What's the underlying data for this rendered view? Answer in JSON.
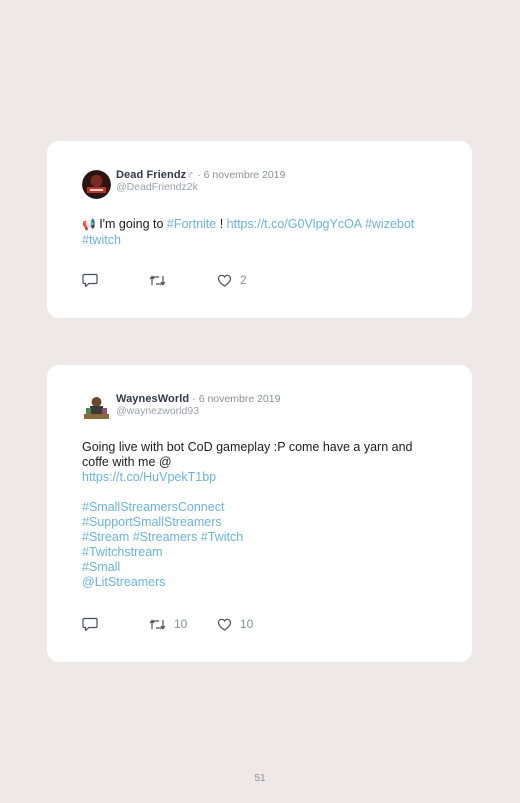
{
  "tweets": [
    {
      "name": "Dead Friendz",
      "name_suffix": "♂",
      "date": "· 6 novembre 2019",
      "handle": "@DeadFriendz2k",
      "emoji": "📢",
      "text_pre": "I'm going to ",
      "hashtag_1": "#Fortnite",
      "text_mid": " ! ",
      "url": "https://t.co/G0VlpgYcOA",
      "hashtag_2": "#wizebot",
      "hashtag_3": "#twitch",
      "retweets": "",
      "likes": "2"
    },
    {
      "name": "WaynesWorld",
      "date": "· 6 novembre 2019",
      "handle": "@waynezworld93",
      "text_1": "Going live with bot CoD gameplay :P come have a yarn and coffe with me @",
      "url": "https://t.co/HuVpekT1bp",
      "hashtags": [
        "#SmallStreamersConnect",
        "#SupportSmallStreamers",
        "#Stream #Streamers #Twitch",
        "#Twitchstream",
        "#Small",
        "@LitStreamers"
      ],
      "retweets": "10",
      "likes": "10"
    }
  ],
  "page_number": "51",
  "colors": {
    "link": "#6ab4dd",
    "background": "#eee8e8",
    "card": "#ffffff"
  }
}
